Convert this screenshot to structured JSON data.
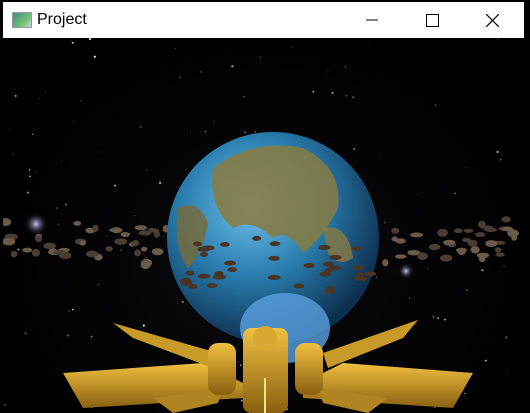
{
  "window": {
    "title": "Project",
    "icon": "app-window-icon"
  },
  "controls": {
    "minimize": "minimize-icon",
    "maximize": "maximize-icon",
    "close": "close-icon"
  },
  "scene": {
    "description_objects": [
      "earth-planet",
      "asteroid-belt",
      "spaceship",
      "starfield"
    ],
    "accent": "#d4a020",
    "planet_ocean": "#2a7fb0"
  }
}
